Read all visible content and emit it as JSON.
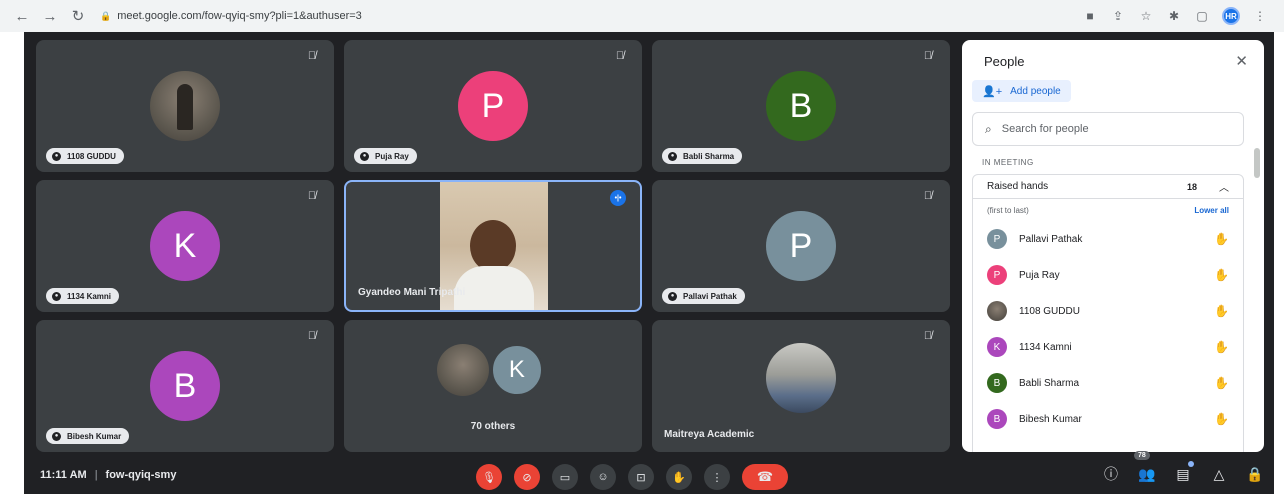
{
  "browser": {
    "url": "meet.google.com/fow-qyiq-smy?pli=1&authuser=3",
    "profile_initials": "HR",
    "icons": [
      "back-icon",
      "forward-icon",
      "reload-icon",
      "lock-icon",
      "camera-icon",
      "share-icon",
      "star-icon",
      "extensions-icon",
      "sidepanel-icon",
      "menu-icon"
    ]
  },
  "tiles": [
    {
      "name": "1108 GUDDU",
      "avatar_type": "photo",
      "muted": true
    },
    {
      "name": "Puja Ray",
      "avatar_type": "letter",
      "letter": "P",
      "color": "#ec407a",
      "muted": true
    },
    {
      "name": "Babli Sharma",
      "avatar_type": "letter",
      "letter": "B",
      "color": "#33691e",
      "muted": true
    },
    {
      "name": "1134 Kamni",
      "avatar_type": "letter",
      "letter": "K",
      "color": "#ab47bc",
      "muted": true
    },
    {
      "name": "Gyandeo Mani Tripathi",
      "avatar_type": "video",
      "speaking": true
    },
    {
      "name": "Pallavi Pathak",
      "avatar_type": "letter",
      "letter": "P",
      "color": "#78909c",
      "muted": true
    },
    {
      "name": "Bibesh Kumar",
      "avatar_type": "letter",
      "letter": "B",
      "color": "#ab47bc",
      "muted": true
    },
    {
      "name": "70 others",
      "avatar_type": "group",
      "letter": "K",
      "color": "#78909c"
    },
    {
      "name": "Maitreya Academic",
      "avatar_type": "classroom",
      "muted": true
    }
  ],
  "bottom": {
    "time": "11:11 AM",
    "meeting_code": "fow-qyiq-smy",
    "participant_count": "78"
  },
  "panel": {
    "title": "People",
    "add_people": "Add people",
    "search_placeholder": "Search for people",
    "section": "IN MEETING",
    "raised_hands_label": "Raised hands",
    "raised_hands_count": "18",
    "order_label": "(first to last)",
    "lower_all": "Lower all",
    "people": [
      {
        "name": "Pallavi Pathak",
        "letter": "P",
        "color": "#78909c"
      },
      {
        "name": "Puja Ray",
        "letter": "P",
        "color": "#ec407a"
      },
      {
        "name": "1108 GUDDU",
        "letter": "",
        "color": "photo"
      },
      {
        "name": "1134 Kamni",
        "letter": "K",
        "color": "#ab47bc"
      },
      {
        "name": "Babli Sharma",
        "letter": "B",
        "color": "#33691e"
      },
      {
        "name": "Bibesh Kumar",
        "letter": "B",
        "color": "#ab47bc"
      }
    ]
  }
}
